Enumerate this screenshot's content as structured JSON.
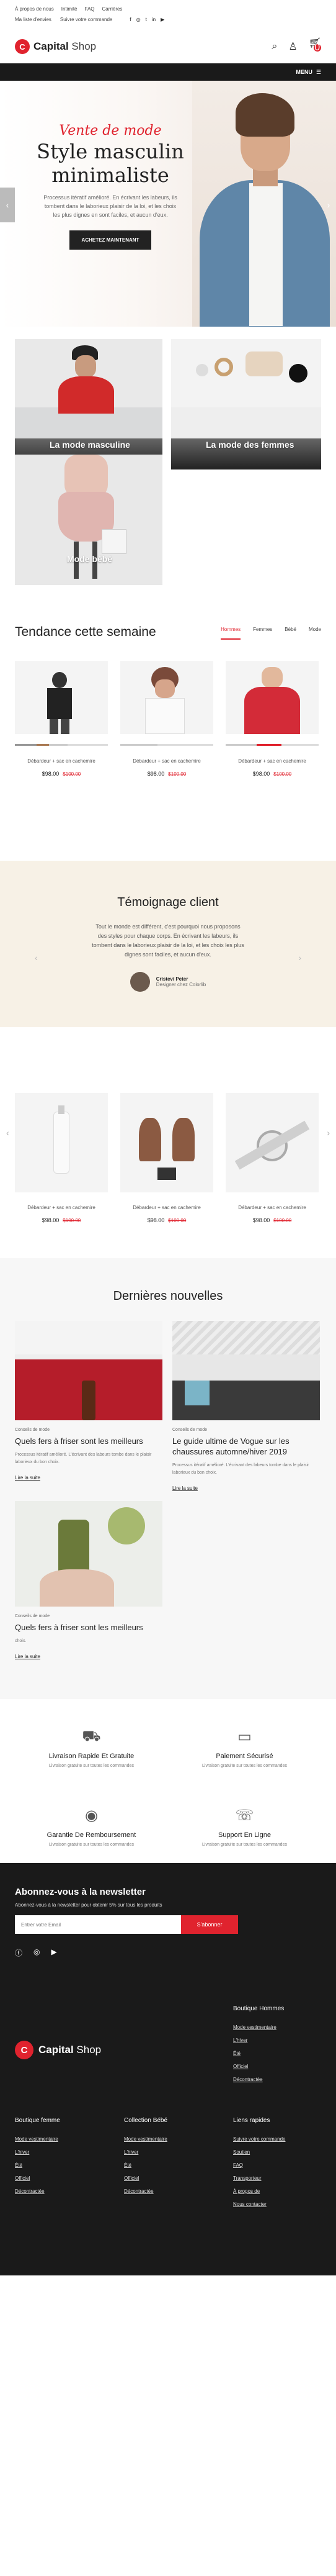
{
  "topbar": {
    "links": [
      "À propos de nous",
      "Intimité",
      "FAQ",
      "Carrières"
    ],
    "account_links": [
      "Ma liste d'envies",
      "Suivre votre commande"
    ],
    "social": [
      "facebook-icon",
      "instagram-icon",
      "twitter-icon",
      "linkedin-icon",
      "youtube-icon"
    ]
  },
  "header": {
    "logo_text": "Capital",
    "logo_sub": "Shop",
    "cart_count": "0",
    "icons": [
      "search-icon",
      "user-icon",
      "cart-icon"
    ]
  },
  "nav": {
    "menu_label": "MENU"
  },
  "hero": {
    "script": "Vente de mode",
    "title": "Style masculin minimaliste",
    "desc": "Processus itératif amélioré. En écrivant les labeurs, ils tombent dans le laborieux plaisir de la loi, et les choix les plus dignes en sont faciles, et aucun d'eux.",
    "button": "ACHETEZ MAINTENANT"
  },
  "categories": [
    "La mode masculine",
    "La mode des femmes",
    "Mode bébé"
  ],
  "trend": {
    "title": "Tendance cette semaine",
    "tabs": [
      "Hommes",
      "Femmes",
      "Bébé",
      "Mode"
    ],
    "products": [
      {
        "name": "Débardeur + sac en cachemire",
        "price": "$98.00",
        "old": "$100.00"
      },
      {
        "name": "Débardeur + sac en cachemire",
        "price": "$98.00",
        "old": "$100.00"
      },
      {
        "name": "Débardeur + sac en cachemire",
        "price": "$98.00",
        "old": "$100.00"
      }
    ]
  },
  "testimonial": {
    "title": "Témoignage client",
    "text": "Tout le monde est différent, c'est pourquoi nous proposons des styles pour chaque corps. En écrivant les labeurs, ils tombent dans le laborieux plaisir de la loi, et les choix les plus dignes sont faciles, et aucun d'eux.",
    "author": "Cristeví Peter",
    "role": "Designer chez Colorlib"
  },
  "products2": [
    {
      "name": "Débardeur + sac en cachemire",
      "price": "$98.00",
      "old": "$100.00"
    },
    {
      "name": "Débardeur + sac en cachemire",
      "price": "$98.00",
      "old": "$100.00"
    },
    {
      "name": "Débardeur + sac en cachemire",
      "price": "$98.00",
      "old": "$100.00"
    }
  ],
  "news": {
    "title": "Dernières nouvelles",
    "items": [
      {
        "cat": "Conseils de mode",
        "title": "Quels fers à friser sont les meilleurs",
        "text": "Processus itératif amélioré. L'écrivant des labeurs tombe dans le plaisir laborieux du bon choix.",
        "more": "Lire la suite"
      },
      {
        "cat": "Conseils de mode",
        "title": "Le guide ultime de Vogue sur les chaussures automne/hiver 2019",
        "text": "Processus itératif amélioré. L'écrivant des labeurs tombe dans le plaisir laborieux du bon choix.",
        "more": "Lire la suite"
      },
      {
        "cat": "Conseils de mode",
        "title": "Quels fers à friser sont les meilleurs",
        "text": "choix.",
        "more": "Lire la suite"
      }
    ]
  },
  "services": [
    {
      "title": "Livraison Rapide Et Gratuite",
      "text": "Livraison gratuite sur toutes les commandes",
      "icon": "truck-icon"
    },
    {
      "title": "Paiement Sécurisé",
      "text": "Livraison gratuite sur toutes les commandes",
      "icon": "card-icon"
    },
    {
      "title": "Garantie De Remboursement",
      "text": "Livraison gratuite sur toutes les commandes",
      "icon": "money-icon"
    },
    {
      "title": "Support En Ligne",
      "text": "Livraison gratuite sur toutes les commandes",
      "icon": "support-icon"
    }
  ],
  "footer": {
    "nl_title": "Abonnez-vous à la newsletter",
    "nl_sub": "Abonnez-vous à la newsletter pour obtenir 5% sur tous les produits",
    "nl_placeholder": "Entrer votre Email",
    "nl_button": "S'abonner",
    "logo_text": "Capital",
    "logo_sub": "Shop",
    "col_men": {
      "title": "Boutique Hommes",
      "links": [
        "Mode vestimentaire",
        "L'hiver",
        "Été",
        "Officiel",
        "Décontractée"
      ]
    },
    "col_women": {
      "title": "Boutique femme",
      "links": [
        "Mode vestimentaire",
        "L'hiver",
        "Été",
        "Officiel",
        "Décontractée"
      ]
    },
    "col_baby": {
      "title": "Collection Bébé",
      "links": [
        "Mode vestimentaire",
        "L'hiver",
        "Été",
        "Officiel",
        "Décontractée"
      ]
    },
    "col_quick": {
      "title": "Liens rapides",
      "links": [
        "Suivre votre commande",
        "Soutien",
        "FAQ",
        "Transporteur",
        "À propos de",
        "Nous contacter"
      ]
    }
  },
  "colors": {
    "accent": "#e0232e",
    "dark": "#1a1a1a",
    "cream": "#f7f1e6"
  }
}
